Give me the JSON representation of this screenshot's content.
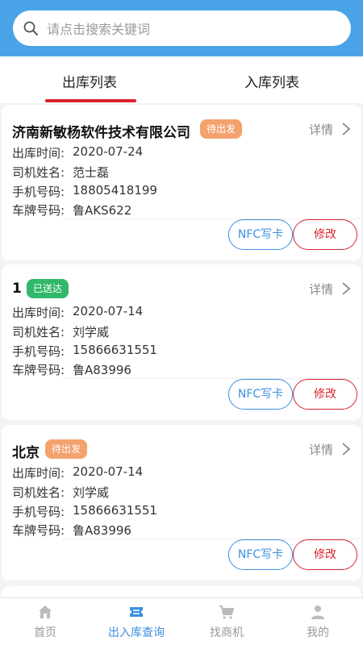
{
  "search": {
    "placeholder": "请点击搜索关键词"
  },
  "tabs": [
    {
      "label": "出库列表",
      "active": true
    },
    {
      "label": "入库列表",
      "active": false
    }
  ],
  "labels": {
    "time": "出库时间:",
    "driver": "司机姓名:",
    "phone": "手机号码:",
    "plate": "车牌号码:",
    "detail": "详情",
    "nfc": "NFC写卡",
    "edit": "修改"
  },
  "cards": [
    {
      "title": "济南新敏杨软件技术有限公司",
      "status": "待出发",
      "status_color": "#f3a26d",
      "time": "2020-07-24",
      "driver": "范士磊",
      "phone": "18805418199",
      "plate": "鲁AKS622"
    },
    {
      "title": "1",
      "status": "已送达",
      "status_color": "#31b86a",
      "time": "2020-07-14",
      "driver": "刘学威",
      "phone": "15866631551",
      "plate": "鲁A83996"
    },
    {
      "title": "北京",
      "status": "待出发",
      "status_color": "#f3a26d",
      "time": "2020-07-14",
      "driver": "刘学威",
      "phone": "15866631551",
      "plate": "鲁A83996"
    }
  ],
  "tabbar": [
    {
      "label": "首页",
      "icon": "home-icon",
      "active": false
    },
    {
      "label": "出入库查询",
      "icon": "ticket-icon",
      "active": true
    },
    {
      "label": "找商机",
      "icon": "cart-icon",
      "active": false
    },
    {
      "label": "我的",
      "icon": "user-icon",
      "active": false
    }
  ],
  "colors": {
    "primary": "#4aa3e6",
    "accent_red": "#d9232e",
    "accent_blue": "#3d8fe0"
  }
}
